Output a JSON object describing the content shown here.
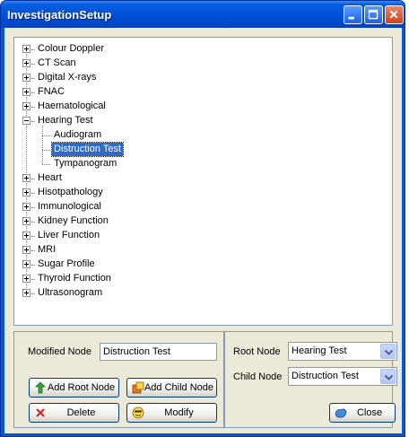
{
  "window": {
    "title": "InvestigationSetup"
  },
  "tree": {
    "items": [
      {
        "label": "Colour Doppler",
        "expander": "plus"
      },
      {
        "label": "CT Scan",
        "expander": "plus"
      },
      {
        "label": "Digital X-rays",
        "expander": "plus"
      },
      {
        "label": "FNAC",
        "expander": "plus"
      },
      {
        "label": "Haematological",
        "expander": "plus"
      },
      {
        "label": "Hearing Test",
        "expander": "minus",
        "children": [
          "Audiogram",
          "Distruction Test",
          "Tympanogram"
        ]
      },
      {
        "label": "Heart",
        "expander": "plus"
      },
      {
        "label": "Hisotpathology",
        "expander": "plus"
      },
      {
        "label": "Immunological",
        "expander": "plus"
      },
      {
        "label": "Kidney Function",
        "expander": "plus"
      },
      {
        "label": "Liver Function",
        "expander": "plus"
      },
      {
        "label": "MRI",
        "expander": "plus"
      },
      {
        "label": "Sugar Profile",
        "expander": "plus"
      },
      {
        "label": "Thyroid Function",
        "expander": "plus"
      },
      {
        "label": "Ultrasonogram",
        "expander": "plus"
      }
    ],
    "selected": "Distruction Test"
  },
  "left_panel": {
    "modified_node_label": "Modified Node",
    "modified_node_value": "Distruction Test",
    "add_root_label": "Add Root Node",
    "add_child_label": "Add Child Node",
    "delete_label": "Delete",
    "modify_label": "Modify"
  },
  "right_panel": {
    "root_node_label": "Root Node",
    "root_node_value": "Hearing Test",
    "child_node_label": "Child Node",
    "child_node_value": "Distruction Test",
    "close_label": "Close"
  },
  "colors": {
    "titlebar": "#0050d8",
    "selection": "#316ac5",
    "face": "#ece9d8"
  },
  "icons": {
    "minimize": "minimize-icon",
    "maximize": "maximize-icon",
    "close": "close-icon",
    "add_root": "green-arrow-icon",
    "add_child": "add-child-icon",
    "delete": "red-x-icon",
    "modify": "smiley-face-icon",
    "close_button": "close-window-icon"
  }
}
